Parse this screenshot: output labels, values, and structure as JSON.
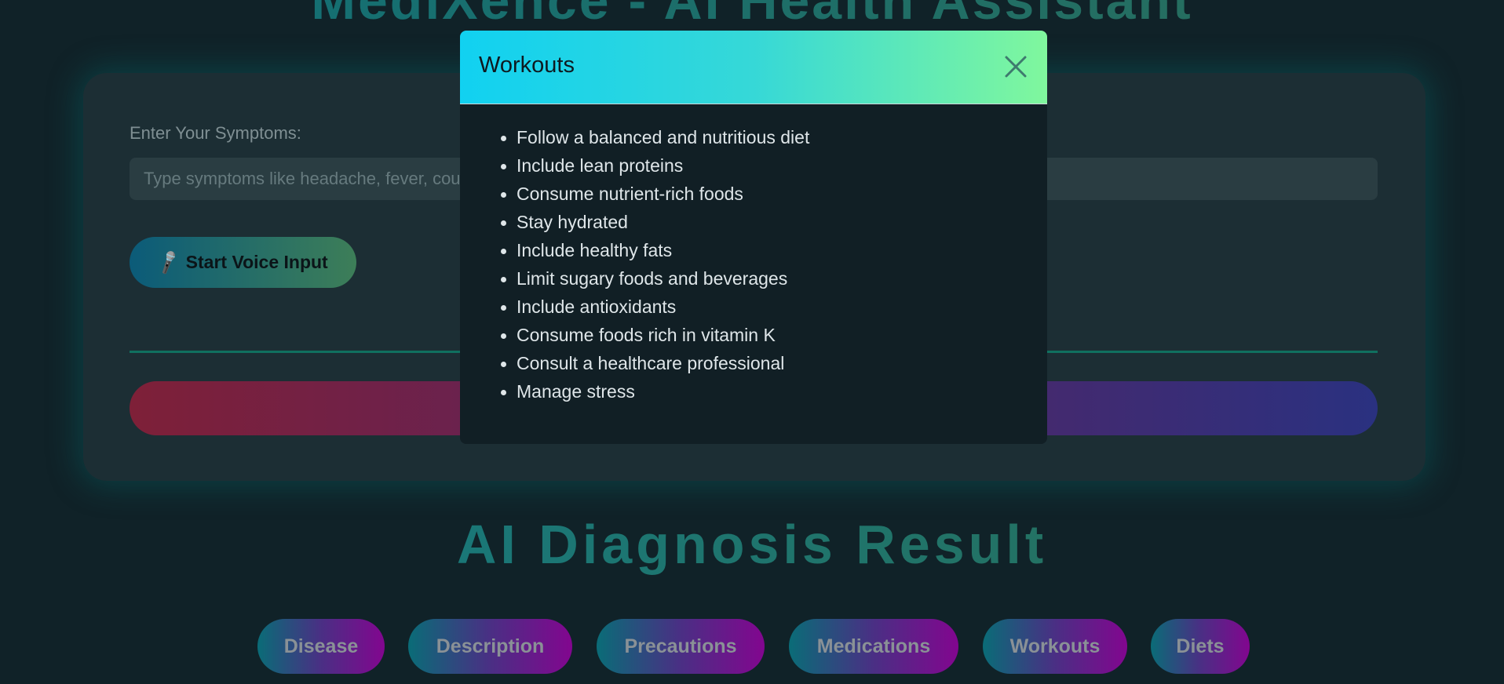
{
  "app": {
    "title": "MediXence - AI Health Assistant"
  },
  "form": {
    "symptoms_label": "Enter Your Symptoms:",
    "symptoms_placeholder": "Type symptoms like headache, fever, cough...",
    "voice_button_label": "Start Voice Input",
    "voice_icon": "microphone-icon"
  },
  "results": {
    "title": "AI Diagnosis Result",
    "tabs": [
      {
        "label": "Disease"
      },
      {
        "label": "Description"
      },
      {
        "label": "Precautions"
      },
      {
        "label": "Medications"
      },
      {
        "label": "Workouts"
      },
      {
        "label": "Diets"
      }
    ]
  },
  "modal": {
    "title": "Workouts",
    "close_icon": "close-icon",
    "items": [
      "Follow a balanced and nutritious diet",
      "Include lean proteins",
      "Consume nutrient-rich foods",
      "Stay hydrated",
      "Include healthy fats",
      "Limit sugary foods and beverages",
      "Include antioxidants",
      "Consume foods rich in vitamin K",
      "Consult a healthcare professional",
      "Manage stress"
    ]
  },
  "colors": {
    "background": "#102228",
    "card": "#1c2e34",
    "accent_teal": "#10705f",
    "modal_header_start": "#11d1f1",
    "modal_header_end": "#80f79d",
    "predict_gradient_start": "#7e2038",
    "predict_gradient_end": "#2a3180"
  }
}
